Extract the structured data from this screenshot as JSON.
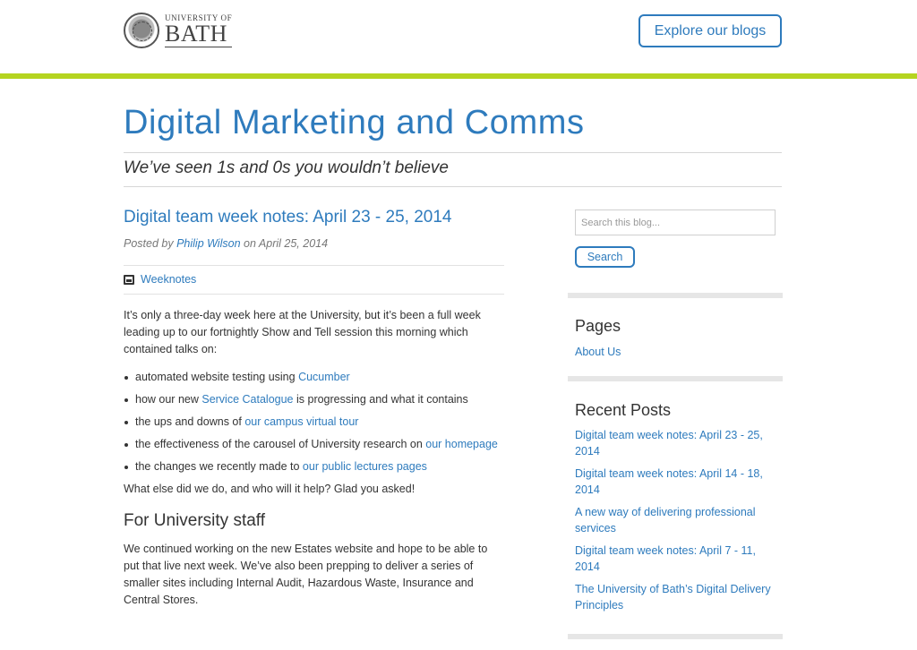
{
  "header": {
    "logo_small": "UNIVERSITY OF",
    "logo_big": "BATH",
    "explore_label": "Explore our blogs"
  },
  "site": {
    "title": "Digital Marketing and Comms",
    "tagline": "We’ve seen 1s and 0s you wouldn’t believe"
  },
  "post": {
    "title": "Digital team week notes: April 23 - 25, 2014",
    "byline_prefix": "Posted by",
    "author": "Philip Wilson",
    "byline_on": "on April 25, 2014",
    "category": "Weeknotes",
    "intro": "It’s only a three-day week here at the University, but it’s been a full week leading up to our fortnightly Show and Tell session  this morning which contained talks on:",
    "bullets": [
      {
        "text": "automated website testing using ",
        "link": "Cucumber",
        "after": ""
      },
      {
        "text": "how our new ",
        "link": "Service Catalogue",
        "after": " is progressing and what it contains"
      },
      {
        "text": "the ups and downs of ",
        "link": "our campus virtual tour",
        "after": ""
      },
      {
        "text": "the effectiveness of the carousel of University research on ",
        "link": "our homepage",
        "after": ""
      },
      {
        "text": "the changes we recently made to ",
        "link": "our public lectures pages",
        "after": ""
      }
    ],
    "followup": "What else did we do, and who will it help? Glad you asked!",
    "subhead": "For University staff",
    "staff_para": "We continued working on the new Estates website and hope to be able to put that live next week. We’ve also been prepping to deliver a series of smaller sites including Internal Audit, Hazardous Waste, Insurance and Central Stores."
  },
  "sidebar": {
    "search_placeholder": "Search this blog...",
    "search_label": "Search",
    "pages_title": "Pages",
    "pages": [
      "About Us"
    ],
    "recent_title": "Recent Posts",
    "recent": [
      "Digital team week notes: April 23 - 25, 2014",
      "Digital team week notes: April 14 - 18, 2014",
      "A new way of delivering professional services",
      "Digital team week notes: April 7 - 11, 2014",
      "The University of Bath’s Digital Delivery Principles"
    ]
  },
  "colors": {
    "accent": "#2e7bbd",
    "green_bar": "#b5d420"
  }
}
